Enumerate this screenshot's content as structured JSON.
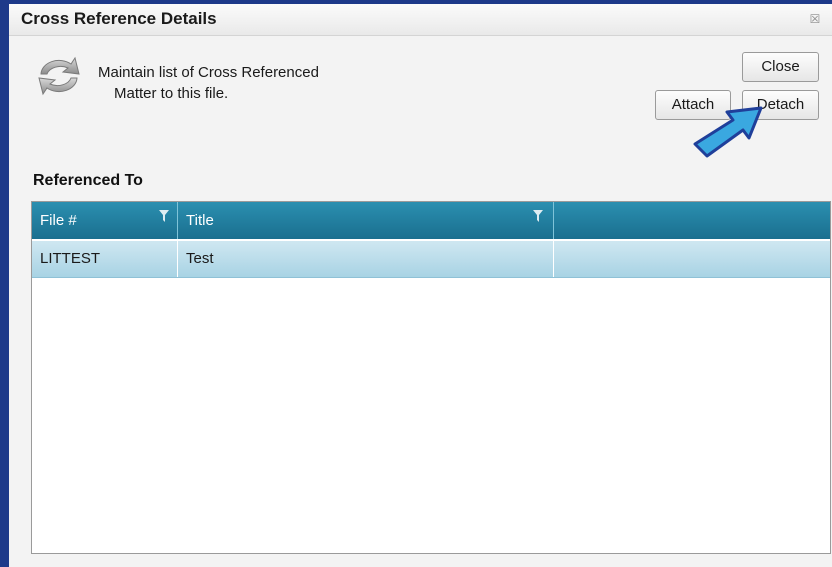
{
  "dialog": {
    "title": "Cross Reference Details",
    "close_glyph": "☒",
    "description_line1": "Maintain list of Cross Referenced",
    "description_line2": "Matter to this file.",
    "header_icon": "refresh-icon"
  },
  "buttons": {
    "close_label": "Close",
    "attach_label": "Attach",
    "detach_label": "Detach"
  },
  "section": {
    "referenced_to_label": "Referenced To"
  },
  "grid": {
    "columns": [
      "File #",
      "Title",
      ""
    ],
    "rows": [
      {
        "file": "LITTEST",
        "title": "Test",
        "extra": ""
      }
    ]
  },
  "colors": {
    "header_bg": "#2186a8",
    "row_selected": "#b9dcea",
    "arrow_fill": "#3aa8e0",
    "frame": "#1e3a8a"
  }
}
